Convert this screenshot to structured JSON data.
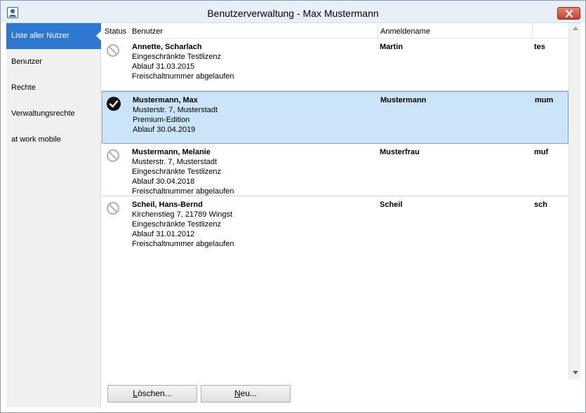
{
  "window": {
    "title": "Benutzerverwaltung - Max Mustermann",
    "app_icon": "user-icon",
    "close_icon": "close-icon",
    "accent_color": "#2f78d2",
    "selected_row_color": "#cce4f7"
  },
  "sidebar": {
    "items": [
      {
        "label": "Liste aller Nutzer",
        "active": true
      },
      {
        "label": "Benutzer",
        "active": false
      },
      {
        "label": "Rechte",
        "active": false
      },
      {
        "label": "Verwaltungsrechte",
        "active": false
      },
      {
        "label": "at work mobile",
        "active": false
      }
    ]
  },
  "table": {
    "headers": {
      "status": "Status",
      "user": "Benutzer",
      "login": "Anmeldename",
      "short": ""
    },
    "rows": [
      {
        "status": "inactive",
        "status_icon": "prohibited-icon",
        "name": "Annette, Scharlach",
        "lines": [
          "Eingeschränkte Testlizenz",
          "Ablauf 31.03.2015",
          "Freischaltnummer abgelaufen"
        ],
        "login": "Martin",
        "short": "tes",
        "selected": false
      },
      {
        "status": "active",
        "status_icon": "checkmark-circle-icon",
        "name": "Mustermann, Max",
        "lines": [
          "Musterstr. 7, Musterstadt",
          "Premium-Edition",
          "Ablauf 30.04.2019"
        ],
        "login": "Mustermann",
        "short": "mum",
        "selected": true
      },
      {
        "status": "inactive",
        "status_icon": "prohibited-icon",
        "name": "Mustermann, Melanie",
        "lines": [
          "Musterstr. 7, Musterstadt",
          "Eingeschränkte Testlizenz",
          "Ablauf 30.04.2018",
          "Freischaltnummer abgelaufen"
        ],
        "login": "Musterfrau",
        "short": "muf",
        "selected": false
      },
      {
        "status": "inactive",
        "status_icon": "prohibited-icon",
        "name": "Scheil, Hans-Bernd",
        "lines": [
          "Kirchenstieg 7, 21789 Wingst",
          "Eingeschränkte Testlizenz",
          "Ablauf 31.01.2012",
          "Freischaltnummer abgelaufen"
        ],
        "login": "Scheil",
        "short": "sch",
        "selected": false
      }
    ]
  },
  "buttons": {
    "delete": {
      "mnemonic": "L",
      "rest": "öschen..."
    },
    "new": {
      "mnemonic": "N",
      "rest": "eu..."
    }
  }
}
